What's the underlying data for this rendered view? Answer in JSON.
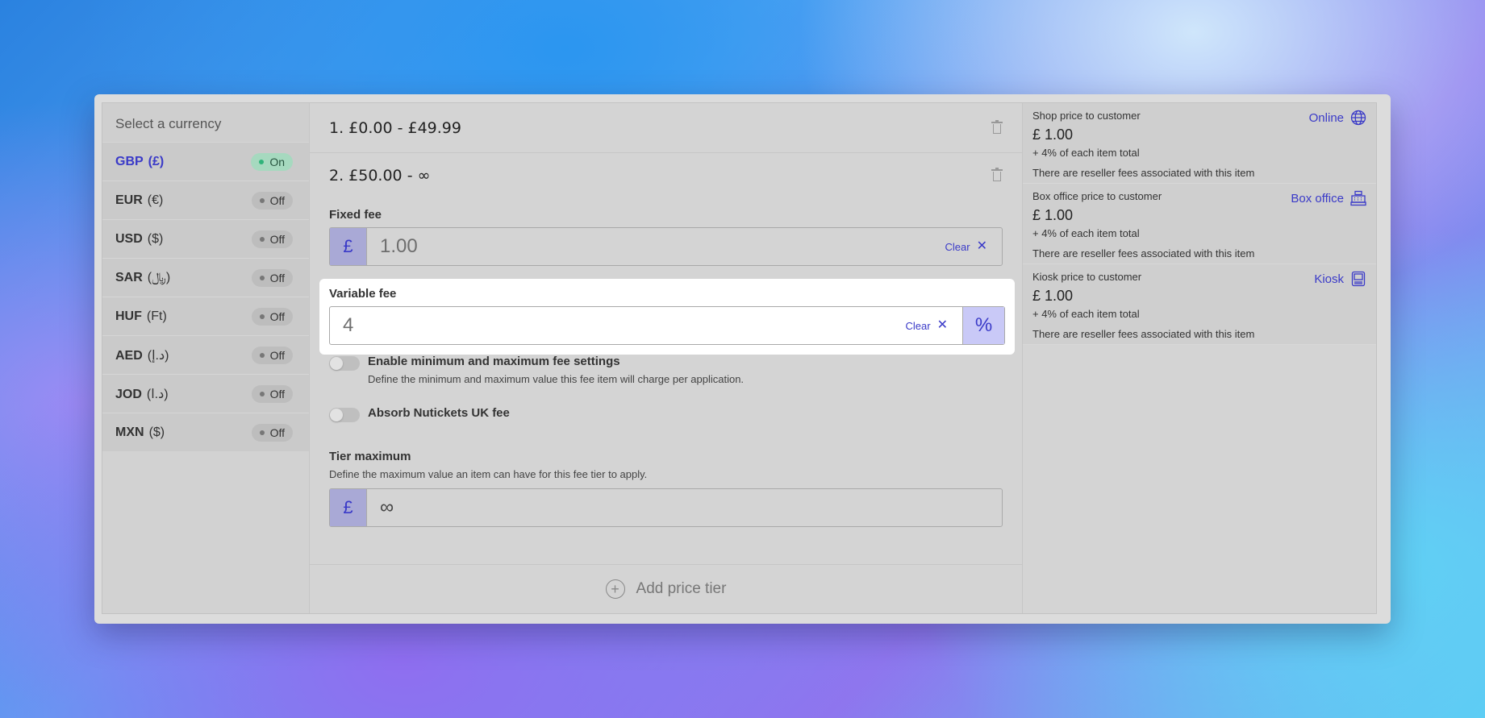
{
  "currencies": {
    "heading": "Select a currency",
    "items": [
      {
        "code": "GBP",
        "symbol": "(£)",
        "status": "On"
      },
      {
        "code": "EUR",
        "symbol": "(€)",
        "status": "Off"
      },
      {
        "code": "USD",
        "symbol": "($)",
        "status": "Off"
      },
      {
        "code": "SAR",
        "symbol": "(﷼)",
        "status": "Off"
      },
      {
        "code": "HUF",
        "symbol": "(Ft)",
        "status": "Off"
      },
      {
        "code": "AED",
        "symbol": "(د.إ)",
        "status": "Off"
      },
      {
        "code": "JOD",
        "symbol": "(د.ا)",
        "status": "Off"
      },
      {
        "code": "MXN",
        "symbol": "($)",
        "status": "Off"
      }
    ]
  },
  "tiers": {
    "tier1": "1. £0.00  -  £49.99",
    "tier2": "2. £50.00  -  ∞",
    "fixed_fee": {
      "label": "Fixed fee",
      "prefix": "£",
      "value": "1.00",
      "clear": "Clear"
    },
    "variable_fee": {
      "label": "Variable fee",
      "value": "4",
      "suffix": "%",
      "clear": "Clear"
    },
    "min_max": {
      "label": "Enable minimum and maximum fee settings",
      "desc": "Define the minimum and maximum value this fee item will charge per application."
    },
    "absorb": {
      "label": "Absorb Nutickets UK fee"
    },
    "tier_max": {
      "label": "Tier maximum",
      "desc": "Define the maximum value an item can have for this fee tier to apply.",
      "prefix": "£",
      "value": "∞"
    },
    "add_tier": "Add price tier"
  },
  "prices": {
    "online": {
      "heading": "Shop price to customer",
      "channel": "Online",
      "value": "£ 1.00",
      "variable": "+ 4% of each item total",
      "note": "There are reseller fees associated with this item"
    },
    "box_office": {
      "heading": "Box office price to customer",
      "channel": "Box office",
      "value": "£ 1.00",
      "variable": "+ 4% of each item total",
      "note": "There are reseller fees associated with this item"
    },
    "kiosk": {
      "heading": "Kiosk price to customer",
      "channel": "Kiosk",
      "value": "£ 1.00",
      "variable": "+ 4% of each item total",
      "note": "There are reseller fees associated with this item"
    }
  },
  "colors": {
    "accent": "#3a3ac8",
    "on_badge": "#a6d9bf"
  },
  "icons": [
    "trash-icon",
    "close-icon",
    "plus-circle-icon",
    "globe-icon",
    "register-icon",
    "kiosk-icon"
  ]
}
